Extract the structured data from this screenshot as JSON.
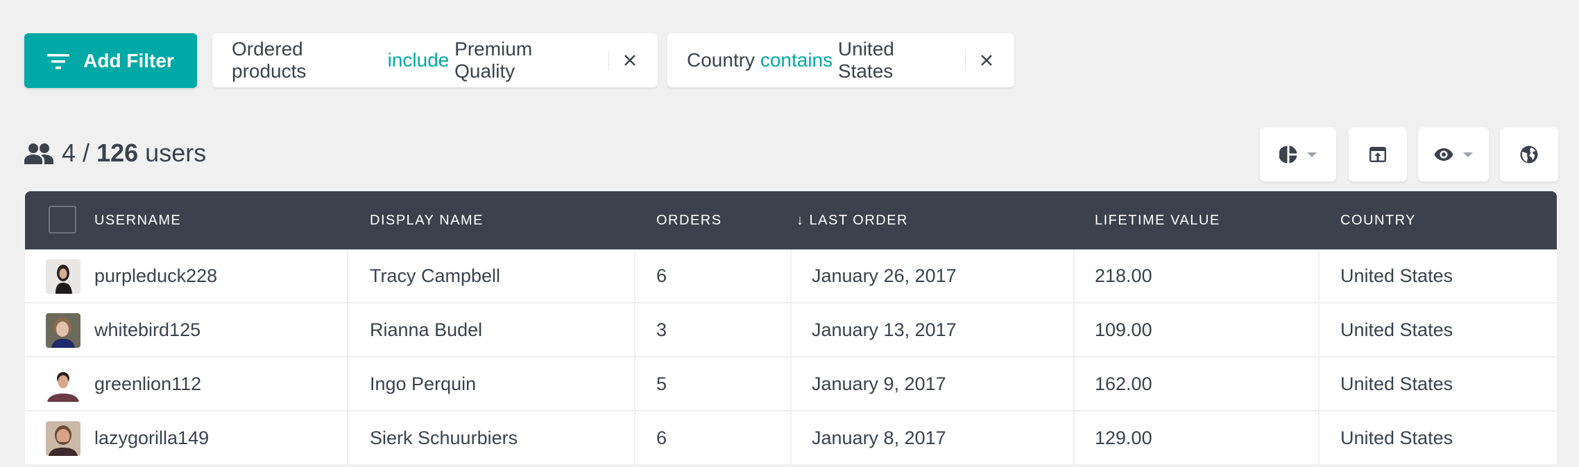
{
  "colors": {
    "accent": "#00a9a5",
    "header_bg": "#3b424d",
    "text": "#3b424d",
    "page_bg": "#f0f0f0"
  },
  "toolbar": {
    "add_filter_label": "Add Filter",
    "add_filter_icon": "filter-list-icon"
  },
  "filters": [
    {
      "field": "Ordered products",
      "operator": "include",
      "value": "Premium Quality",
      "close_icon": "close-icon"
    },
    {
      "field": "Country",
      "operator": "contains",
      "value": "United States",
      "close_icon": "close-icon"
    }
  ],
  "summary": {
    "icon": "people-icon",
    "shown": "4",
    "separator": "/",
    "total": "126",
    "unit": "users"
  },
  "actions": [
    {
      "icon": "pie-chart-icon",
      "has_dropdown": true
    },
    {
      "icon": "export-icon",
      "has_dropdown": false
    },
    {
      "icon": "eye-icon",
      "has_dropdown": true
    },
    {
      "icon": "globe-icon",
      "has_dropdown": false
    }
  ],
  "table": {
    "columns": [
      {
        "label": "USERNAME"
      },
      {
        "label": "DISPLAY NAME"
      },
      {
        "label": "ORDERS"
      },
      {
        "label": "↓ LAST ORDER",
        "sorted": "descending"
      },
      {
        "label": "LIFETIME VALUE"
      },
      {
        "label": "COUNTRY"
      }
    ],
    "rows": [
      {
        "username": "purpleduck228",
        "display_name": "Tracy Campbell",
        "orders": "6",
        "last_order": "January 26, 2017",
        "lifetime_value": "218.00",
        "country": "United States"
      },
      {
        "username": "whitebird125",
        "display_name": "Rianna Budel",
        "orders": "3",
        "last_order": "January 13, 2017",
        "lifetime_value": "109.00",
        "country": "United States"
      },
      {
        "username": "greenlion112",
        "display_name": "Ingo Perquin",
        "orders": "5",
        "last_order": "January 9, 2017",
        "lifetime_value": "162.00",
        "country": "United States"
      },
      {
        "username": "lazygorilla149",
        "display_name": "Sierk Schuurbiers",
        "orders": "6",
        "last_order": "January 8, 2017",
        "lifetime_value": "129.00",
        "country": "United States"
      }
    ]
  }
}
